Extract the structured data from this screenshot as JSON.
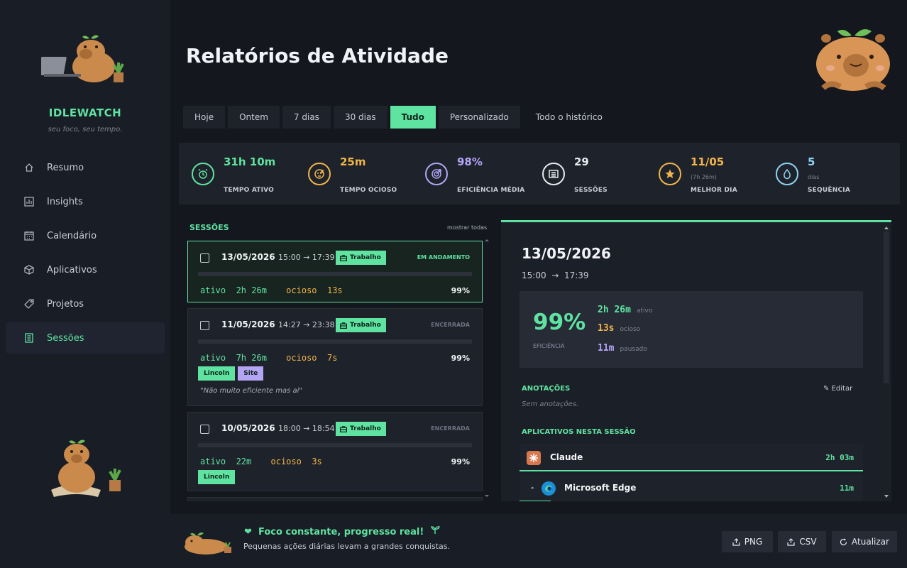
{
  "brand": {
    "name": "IDLEWATCH",
    "tagline": "seu foco, seu tempo."
  },
  "nav": [
    {
      "label": "Resumo",
      "icon": "home-icon"
    },
    {
      "label": "Insights",
      "icon": "bar-chart-icon"
    },
    {
      "label": "Calendário",
      "icon": "calendar-icon"
    },
    {
      "label": "Aplicativos",
      "icon": "cube-icon"
    },
    {
      "label": "Projetos",
      "icon": "tag-icon"
    },
    {
      "label": "Sessões",
      "icon": "sessions-icon",
      "active": true
    }
  ],
  "page": {
    "title": "Relatórios de Atividade"
  },
  "tabs": [
    {
      "label": "Hoje"
    },
    {
      "label": "Ontem"
    },
    {
      "label": "7 dias"
    },
    {
      "label": "30 dias"
    },
    {
      "label": "Tudo",
      "active": true
    },
    {
      "label": "Personalizado"
    },
    {
      "label": "Todo o histórico"
    }
  ],
  "stats": [
    {
      "value": "31h 10m",
      "label": "TEMPO ATIVO",
      "sub": "",
      "color": "#5fe3a1",
      "icon": "alarm-clock-icon"
    },
    {
      "value": "25m",
      "label": "TEMPO OCIOSO",
      "sub": "",
      "color": "#f0b44a",
      "icon": "sleep-face-icon"
    },
    {
      "value": "98%",
      "label": "EFICIÊNCIA MÉDIA",
      "sub": "",
      "color": "#b3a4f5",
      "icon": "target-icon"
    },
    {
      "value": "29",
      "label": "SESSÕES",
      "sub": "",
      "color": "#e6e9ef",
      "icon": "list-icon"
    },
    {
      "value": "11/05",
      "label": "MELHOR DIA",
      "sub": "(7h 26m)",
      "color": "#f0b44a",
      "icon": "star-icon"
    },
    {
      "value": "5",
      "label": "SEQUÊNCIA",
      "sub": "dias",
      "color": "#8fd3f4",
      "icon": "drop-icon"
    }
  ],
  "sessions": {
    "heading": "SESSÕES",
    "show_all": "mostrar todas",
    "items": [
      {
        "date": "13/05/2026",
        "time": "15:00 → 17:39",
        "category": "Trabalho",
        "status": "EM ANDAMENTO",
        "active_label": "ativo",
        "active": "2h 26m",
        "idle_label": "ocioso",
        "idle": "13s",
        "efficiency": "99%",
        "progress": 0.99,
        "tags": [],
        "note": ""
      },
      {
        "date": "11/05/2026",
        "time": "14:27 → 23:38",
        "category": "Trabalho",
        "status": "ENCERRADA",
        "active_label": "ativo",
        "active": "7h 26m",
        "idle_label": "ocioso",
        "idle": "7s",
        "efficiency": "99%",
        "progress": 0.99,
        "tags": [
          "Lincoln",
          "Site"
        ],
        "note": "\"Não muito eficiente mas ai\""
      },
      {
        "date": "10/05/2026",
        "time": "18:00 → 18:54",
        "category": "Trabalho",
        "status": "ENCERRADA",
        "active_label": "ativo",
        "active": "22m",
        "idle_label": "ocioso",
        "idle": "3s",
        "efficiency": "99%",
        "progress": 0.99,
        "tags": [
          "Lincoln"
        ],
        "note": ""
      }
    ]
  },
  "detail": {
    "date": "13/05/2026",
    "time_start": "15:00",
    "arrow": "→",
    "time_end": "17:39",
    "efficiency": "99%",
    "efficiency_label": "EFICIÊNCIA",
    "active": "2h 26m",
    "active_label": "ativo",
    "idle": "13s",
    "idle_label": "ocioso",
    "paused": "11m",
    "paused_label": "pausado",
    "notes_heading": "ANOTAÇÕES",
    "edit_label": "Editar",
    "notes_empty": "Sem anotações.",
    "apps_heading": "APLICATIVOS NESTA SESSÃO",
    "apps": [
      {
        "name": "Claude",
        "time": "2h 03m",
        "icon": "claude-icon"
      },
      {
        "name": "Microsoft Edge",
        "time": "11m",
        "icon": "edge-icon"
      }
    ]
  },
  "footer": {
    "title": "Foco constante, progresso real!",
    "subtitle": "Pequenas ações diárias levam a grandes conquistas.",
    "buttons": {
      "png": "PNG",
      "csv": "CSV",
      "refresh": "Atualizar"
    }
  },
  "colors": {
    "accent": "#5fe3a1",
    "idle": "#f0b44a",
    "paused": "#b3a4f5",
    "bg": "#14171e",
    "panel": "#1e222b"
  }
}
